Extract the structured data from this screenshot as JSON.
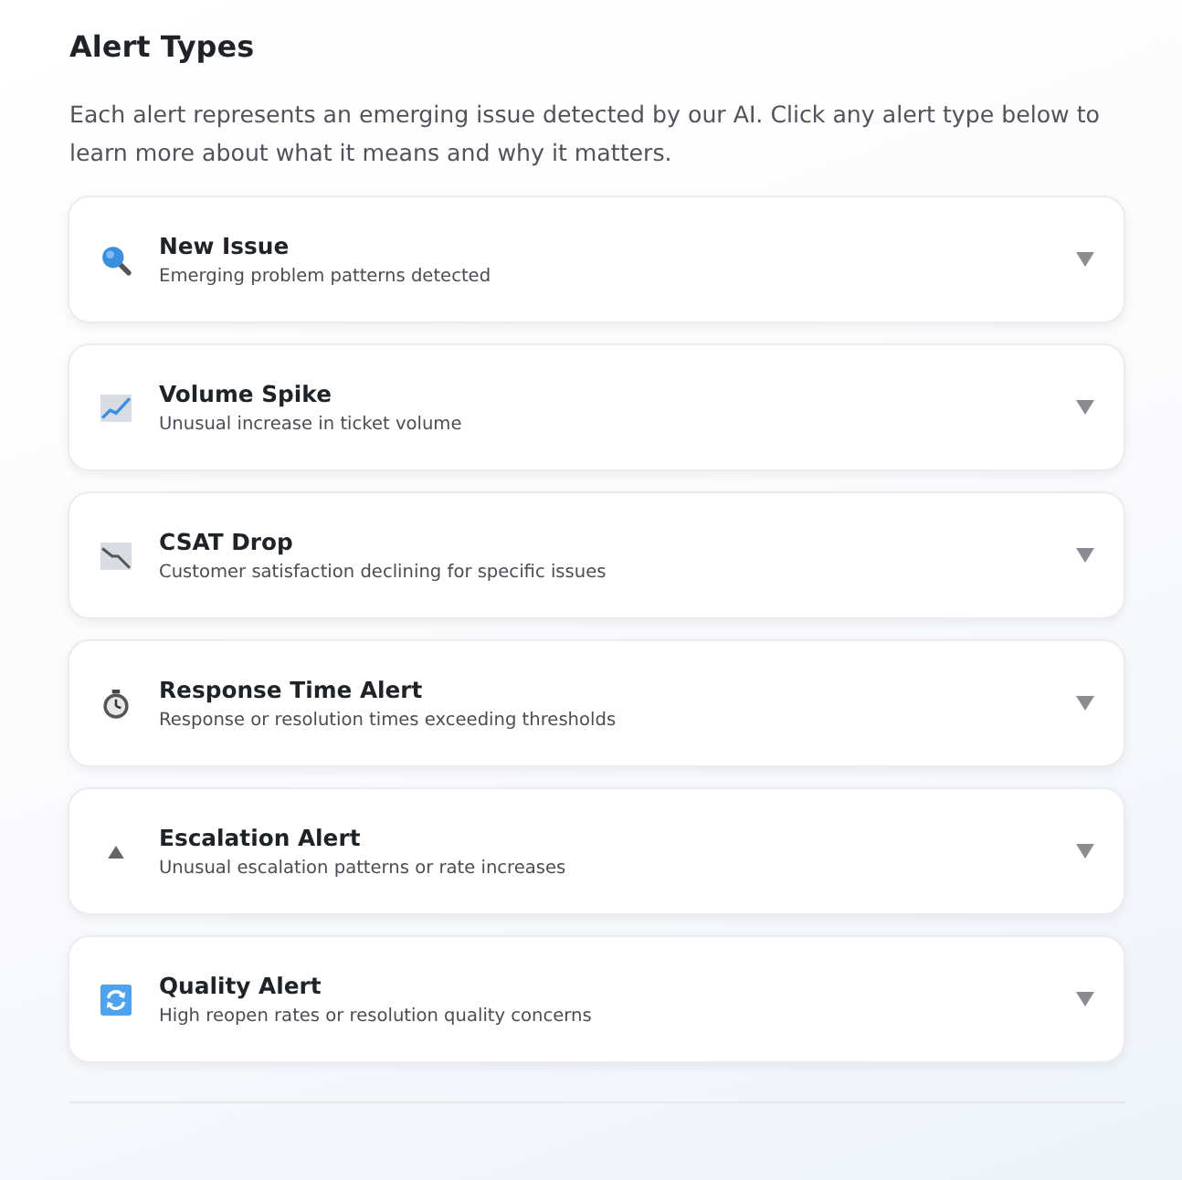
{
  "heading": "Alert Types",
  "intro": "Each alert represents an emerging issue detected by our AI. Click any alert type below to learn more about what it means and why it matters.",
  "alert_types": [
    {
      "title": "New Issue",
      "description": "Emerging problem patterns detected",
      "expanded": false
    },
    {
      "title": "Volume Spike",
      "description": "Unusual increase in ticket volume",
      "expanded": false
    },
    {
      "title": "CSAT Drop",
      "description": "Customer satisfaction declining for specific issues",
      "expanded": false
    },
    {
      "title": "Response Time Alert",
      "description": "Response or resolution times exceeding thresholds",
      "expanded": false
    },
    {
      "title": "Escalation Alert",
      "description": "Unusual escalation patterns or rate increases",
      "expanded": false
    },
    {
      "title": "Quality Alert",
      "description": "High reopen rates or resolution quality concerns",
      "expanded": false
    }
  ]
}
